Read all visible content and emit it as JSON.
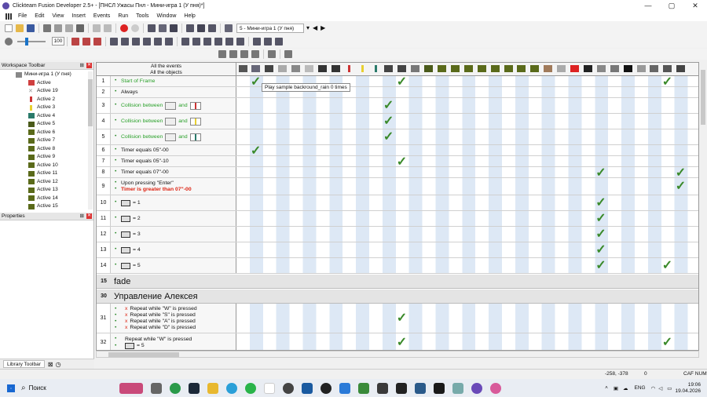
{
  "window": {
    "title": "Clickteam Fusion Developer 2.5+ - [ПНСЛ Ужасы Пнл - Мини-игра 1 (У пня)*]",
    "min": "—",
    "max": "▢",
    "close": "✕"
  },
  "menu": [
    "File",
    "Edit",
    "View",
    "Insert",
    "Events",
    "Run",
    "Tools",
    "Window",
    "Help"
  ],
  "toolbar": {
    "frame_select": "5 - Мини-игра 1 (У пня)",
    "zoom": "100"
  },
  "workspace": {
    "title": "Workspace Toolbar",
    "items": [
      {
        "label": "Мини-игра 1 (У пня)",
        "color": "#888"
      },
      {
        "label": "Active",
        "color": "#d04040"
      },
      {
        "label": "Active 19",
        "color": "#aaa"
      },
      {
        "label": "Active 2",
        "color": "#c33"
      },
      {
        "label": "Active 3",
        "color": "#e8d030"
      },
      {
        "label": "Active 4",
        "color": "#2a7a6a"
      },
      {
        "label": "Active 5",
        "color": "#4a5a1a"
      },
      {
        "label": "Active 6",
        "color": "#5a6a1a"
      },
      {
        "label": "Active 7",
        "color": "#5a6a1a"
      },
      {
        "label": "Active 8",
        "color": "#5a6a1a"
      },
      {
        "label": "Active 9",
        "color": "#5a6a1a"
      },
      {
        "label": "Active 10",
        "color": "#5a6a1a"
      },
      {
        "label": "Active 11",
        "color": "#5a6a1a"
      },
      {
        "label": "Active 12",
        "color": "#5a6a1a"
      },
      {
        "label": "Active 13",
        "color": "#5a6a1a"
      },
      {
        "label": "Active 14",
        "color": "#5a6a1a"
      },
      {
        "label": "Active 15",
        "color": "#5a6a1a"
      }
    ]
  },
  "properties": {
    "title": "Properties"
  },
  "library": {
    "tab": "Library Toolbar"
  },
  "editor": {
    "header_line1": "All the events",
    "header_line2": "All the objects",
    "tooltip": "Play sample backround_rain 0 times",
    "rows": [
      {
        "num": "1",
        "lines": [
          {
            "t": "Start of Frame",
            "c": "green"
          }
        ]
      },
      {
        "num": "2",
        "lines": [
          {
            "t": "Always",
            "c": ""
          }
        ]
      },
      {
        "num": "3",
        "lines": [
          {
            "t": "Collision between",
            "c": "green",
            "icons": [
              "#888",
              "#c33"
            ]
          }
        ]
      },
      {
        "num": "4",
        "lines": [
          {
            "t": "Collision between",
            "c": "green",
            "icons": [
              "#888",
              "#e8d030"
            ]
          }
        ]
      },
      {
        "num": "5",
        "lines": [
          {
            "t": "Collision between",
            "c": "green",
            "icons": [
              "#888",
              "#2a7a6a"
            ]
          }
        ]
      },
      {
        "num": "6",
        "lines": [
          {
            "t": "Timer equals 05\"-00",
            "c": ""
          }
        ]
      },
      {
        "num": "7",
        "lines": [
          {
            "t": "Timer equals 05\"-10",
            "c": ""
          }
        ]
      },
      {
        "num": "8",
        "lines": [
          {
            "t": "Timer equals 07\"-00",
            "c": ""
          }
        ]
      },
      {
        "num": "9",
        "lines": [
          {
            "t": "Upon pressing \"Enter\"",
            "c": ""
          },
          {
            "t": "Timer is greater than 07\"-00",
            "c": "red"
          }
        ]
      },
      {
        "num": "10",
        "lines": [
          {
            "t": "= 1",
            "c": "",
            "pre": true
          }
        ]
      },
      {
        "num": "11",
        "lines": [
          {
            "t": "= 2",
            "c": "",
            "pre": true
          }
        ]
      },
      {
        "num": "12",
        "lines": [
          {
            "t": "= 3",
            "c": "",
            "pre": true
          }
        ]
      },
      {
        "num": "13",
        "lines": [
          {
            "t": "= 4",
            "c": "",
            "pre": true
          }
        ]
      },
      {
        "num": "14",
        "lines": [
          {
            "t": "= 5",
            "c": "",
            "pre": true
          }
        ]
      }
    ],
    "sections": [
      {
        "num": "15",
        "label": "fade"
      },
      {
        "num": "30",
        "label": "Управление Алексея"
      }
    ],
    "row31": {
      "num": "31",
      "lines": [
        "Repeat while \"W\" is pressed",
        "Repeat while \"S\" is pressed",
        "Repeat while \"A\" is pressed",
        "Repeat while \"D\" is pressed"
      ]
    },
    "row32": {
      "num": "32",
      "lines": [
        "Repeat while \"W\" is pressed",
        "= 5"
      ]
    }
  },
  "status": {
    "coords": "-258, -378",
    "zero": "0",
    "caps": "CAF NUM"
  },
  "taskbar": {
    "search": "Поиск",
    "lang": "ENG",
    "time": "19:06",
    "date": "19.04.2026"
  }
}
